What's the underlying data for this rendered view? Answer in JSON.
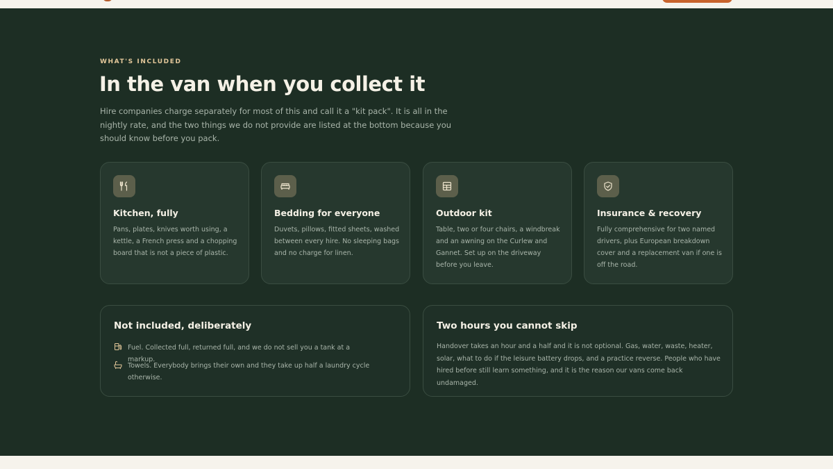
{
  "section": {
    "eyebrow": "WHAT'S INCLUDED",
    "heading": "In the van when you collect it",
    "lede": "Hire companies charge separately for most of this and call it a \"kit pack\". It is all in the nightly rate, and the two things we do not provide are listed at the bottom because you should know before you pack."
  },
  "cards": [
    {
      "icon": "utensils-icon",
      "title": "Kitchen, fully",
      "body": "Pans, plates, knives worth using, a kettle, a French press and a chopping board that is not a piece of plastic."
    },
    {
      "icon": "bed-icon",
      "title": "Bedding for everyone",
      "body": "Duvets, pillows, fitted sheets, washed between every hire. No sleeping bags and no charge for linen."
    },
    {
      "icon": "grid-icon",
      "title": "Outdoor kit",
      "body": "Table, two or four chairs, a windbreak and an awning on the Curlew and Gannet. Set up on the driveway before you leave."
    },
    {
      "icon": "shield-check-icon",
      "title": "Insurance & recovery",
      "body": "Fully comprehensive for two named drivers, plus European breakdown cover and a replacement van if one is off the road."
    }
  ],
  "not_included": {
    "title": "Not included, deliberately",
    "items": [
      {
        "icon": "fuel-icon",
        "text": "Fuel. Collected full, returned full, and we do not sell you a tank at a markup."
      },
      {
        "icon": "bath-icon",
        "text": "Towels. Everybody brings their own and they take up half a laundry cycle otherwise."
      }
    ]
  },
  "handover": {
    "title": "Two hours you cannot skip",
    "body": "Handover takes an hour and a half and it is not optional. Gas, water, waste, heater, solar, what to do if the leisure battery drops, and a practice reverse. People who have hired before still learn something, and it is the reason our vans come back undamaged."
  },
  "colors": {
    "section_bg": "#1d2e24",
    "card_bg": "#26382e",
    "accent": "#c8632c",
    "eyebrow": "#e3c79a"
  }
}
